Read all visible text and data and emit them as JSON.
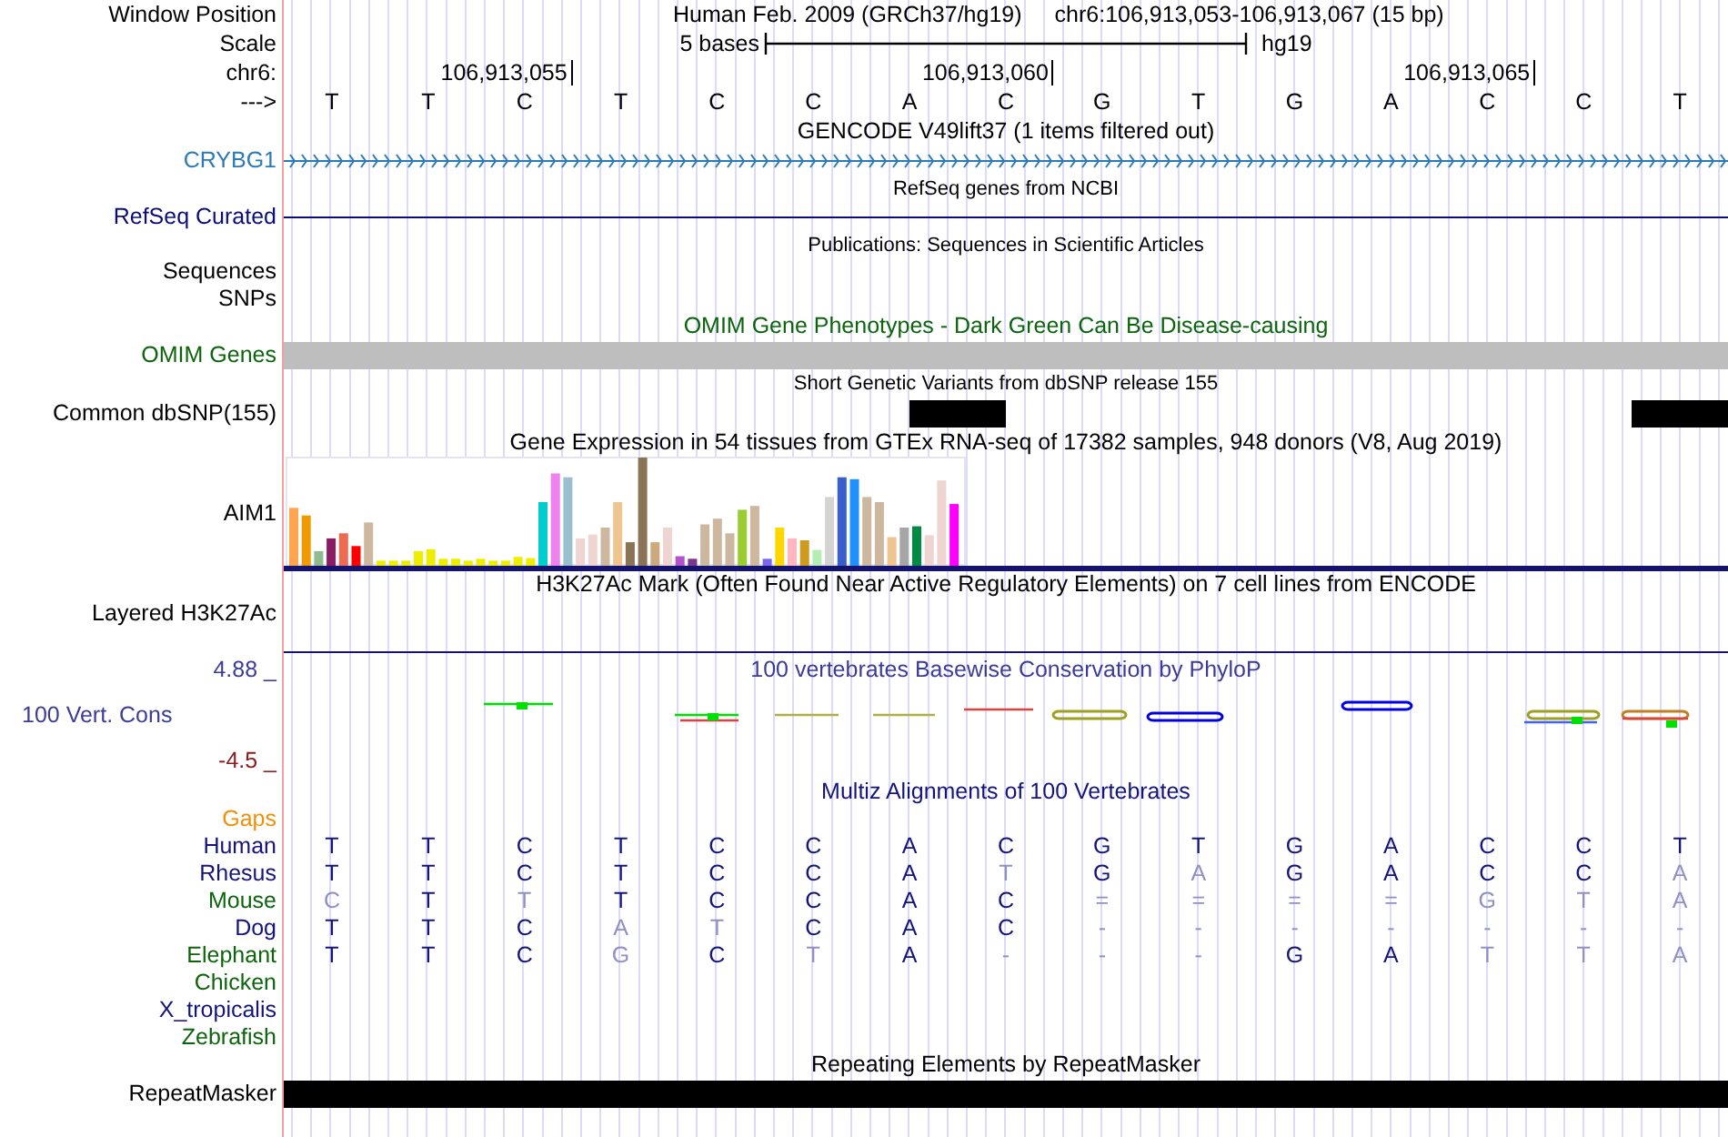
{
  "header": {
    "position_label": "Window Position",
    "assembly_name": "Human Feb. 2009 (GRCh37/hg19)",
    "range": "chr6:106,913,053-106,913,067 (15 bp)",
    "scale_label": "Scale",
    "scale_text": "5 bases",
    "scale_assembly": "hg19",
    "chrom_label": "chr6:",
    "ticks": [
      "106,913,055",
      "106,913,060",
      "106,913,065"
    ],
    "strand_label": "--->",
    "bases": [
      "T",
      "T",
      "C",
      "T",
      "C",
      "C",
      "A",
      "C",
      "G",
      "T",
      "G",
      "A",
      "C",
      "C",
      "T"
    ]
  },
  "tracks": [
    {
      "kind": "title",
      "text": "GENCODE V49lift37 (1 items filtered out)",
      "color": "#000000"
    },
    {
      "kind": "gene",
      "label": "CRYBG1",
      "color": "#2c7bb6"
    },
    {
      "kind": "small_title",
      "text": "RefSeq genes from NCBI",
      "color": "#000000"
    },
    {
      "kind": "line",
      "label": "RefSeq Curated",
      "color": "#0c0c78"
    },
    {
      "kind": "small_title",
      "text": "Publications: Sequences in Scientific Articles",
      "color": "#000000"
    },
    {
      "kind": "label",
      "label": "Sequences",
      "color": "#000000"
    },
    {
      "kind": "label",
      "label": "SNPs",
      "color": "#000000"
    },
    {
      "kind": "title",
      "text": "OMIM Gene Phenotypes - Dark Green Can Be Disease-causing",
      "color": "#0c640c"
    },
    {
      "kind": "bar",
      "label": "OMIM Genes",
      "color": "#0c640c",
      "bar": {
        "color": "#bebebe"
      }
    },
    {
      "kind": "small_title",
      "text": "Short Genetic Variants from dbSNP release 155",
      "color": "#000000"
    },
    {
      "kind": "variants",
      "label": "Common dbSNP(155)",
      "color": "#000000",
      "marks": [
        false,
        false,
        false,
        false,
        false,
        false,
        false,
        false,
        false,
        false,
        false,
        false,
        false,
        true,
        true,
        false,
        false,
        false,
        false,
        false,
        false,
        false,
        false,
        false,
        false,
        false,
        false,
        false,
        true,
        true
      ]
    },
    {
      "kind": "title",
      "text": "Gene Expression in 54 tissues from GTEx RNA-seq of 17382 samples, 948 donors (V8, Aug 2019)",
      "color": "#000000"
    },
    {
      "kind": "expression",
      "label": "AIM1",
      "color": "#000000"
    },
    {
      "kind": "title",
      "text": "H3K27Ac Mark (Often Found Near Active Regulatory Elements) on 7 cell lines from ENCODE",
      "color": "#000000"
    },
    {
      "kind": "layered",
      "label": "Layered H3K27Ac",
      "color": "#000000"
    },
    {
      "kind": "conservation",
      "upper": "4.88 _",
      "label": "100 Vert. Cons",
      "lower": "-4.5 _",
      "text": "100 vertebrates Basewise Conservation by PhyloP",
      "color": "#3c3c96"
    },
    {
      "kind": "title",
      "text": "Multiz Alignments of 100 Vertebrates",
      "color": "#14147a"
    },
    {
      "kind": "label",
      "label": "Gaps",
      "color": "#f0900a"
    },
    {
      "kind": "alignment",
      "label": "Human",
      "color": "#14147a",
      "cells": [
        {
          "base": "T",
          "dim": false
        },
        {
          "base": "T",
          "dim": false
        },
        {
          "base": "C",
          "dim": false
        },
        {
          "base": "T",
          "dim": false
        },
        {
          "base": "C",
          "dim": false
        },
        {
          "base": "C",
          "dim": false
        },
        {
          "base": "A",
          "dim": false
        },
        {
          "base": "C",
          "dim": false
        },
        {
          "base": "G",
          "dim": false
        },
        {
          "base": "T",
          "dim": false
        },
        {
          "base": "G",
          "dim": false
        },
        {
          "base": "A",
          "dim": false
        },
        {
          "base": "C",
          "dim": false
        },
        {
          "base": "C",
          "dim": false
        },
        {
          "base": "T",
          "dim": false
        }
      ]
    },
    {
      "kind": "alignment",
      "label": "Rhesus",
      "color": "#14147a",
      "cells": [
        {
          "base": "T",
          "dim": false
        },
        {
          "base": "T",
          "dim": false
        },
        {
          "base": "C",
          "dim": false
        },
        {
          "base": "T",
          "dim": false
        },
        {
          "base": "C",
          "dim": false
        },
        {
          "base": "C",
          "dim": false
        },
        {
          "base": "A",
          "dim": false
        },
        {
          "base": "T",
          "dim": true
        },
        {
          "base": "G",
          "dim": false
        },
        {
          "base": "A",
          "dim": true
        },
        {
          "base": "G",
          "dim": false
        },
        {
          "base": "A",
          "dim": false
        },
        {
          "base": "C",
          "dim": false
        },
        {
          "base": "C",
          "dim": false
        },
        {
          "base": "A",
          "dim": true
        }
      ]
    },
    {
      "kind": "alignment",
      "label": "Mouse",
      "color": "#0c640c",
      "cells": [
        {
          "base": "C",
          "dim": true
        },
        {
          "base": "T",
          "dim": false
        },
        {
          "base": "T",
          "dim": true
        },
        {
          "base": "T",
          "dim": false
        },
        {
          "base": "C",
          "dim": false
        },
        {
          "base": "C",
          "dim": false
        },
        {
          "base": "A",
          "dim": false
        },
        {
          "base": "C",
          "dim": false
        },
        {
          "base": "=",
          "dim": true
        },
        {
          "base": "=",
          "dim": true
        },
        {
          "base": "=",
          "dim": true
        },
        {
          "base": "=",
          "dim": true
        },
        {
          "base": "G",
          "dim": true
        },
        {
          "base": "T",
          "dim": true
        },
        {
          "base": "A",
          "dim": true
        }
      ]
    },
    {
      "kind": "alignment",
      "label": "Dog",
      "color": "#14147a",
      "cells": [
        {
          "base": "T",
          "dim": false
        },
        {
          "base": "T",
          "dim": false
        },
        {
          "base": "C",
          "dim": false
        },
        {
          "base": "A",
          "dim": true
        },
        {
          "base": "T",
          "dim": true
        },
        {
          "base": "C",
          "dim": false
        },
        {
          "base": "A",
          "dim": false
        },
        {
          "base": "C",
          "dim": false
        },
        {
          "base": "-",
          "dim": true
        },
        {
          "base": "-",
          "dim": true
        },
        {
          "base": "-",
          "dim": true
        },
        {
          "base": "-",
          "dim": true
        },
        {
          "base": "-",
          "dim": true
        },
        {
          "base": "-",
          "dim": true
        },
        {
          "base": "-",
          "dim": true
        }
      ]
    },
    {
      "kind": "alignment",
      "label": "Elephant",
      "color": "#0c640c",
      "cells": [
        {
          "base": "T",
          "dim": false
        },
        {
          "base": "T",
          "dim": false
        },
        {
          "base": "C",
          "dim": false
        },
        {
          "base": "G",
          "dim": true
        },
        {
          "base": "C",
          "dim": false
        },
        {
          "base": "T",
          "dim": true
        },
        {
          "base": "A",
          "dim": false
        },
        {
          "base": "-",
          "dim": true
        },
        {
          "base": "-",
          "dim": true
        },
        {
          "base": "-",
          "dim": true
        },
        {
          "base": "G",
          "dim": false
        },
        {
          "base": "A",
          "dim": false
        },
        {
          "base": "T",
          "dim": true
        },
        {
          "base": "T",
          "dim": true
        },
        {
          "base": "A",
          "dim": true
        }
      ]
    },
    {
      "kind": "label",
      "label": "Chicken",
      "color": "#0c640c"
    },
    {
      "kind": "label",
      "label": "X_tropicalis",
      "color": "#14147a"
    },
    {
      "kind": "label",
      "label": "Zebrafish",
      "color": "#0c640c"
    },
    {
      "kind": "title",
      "text": "Repeating Elements by RepeatMasker",
      "color": "#000000"
    },
    {
      "kind": "bar",
      "label": "RepeatMasker",
      "color": "#000000",
      "bar": {
        "color": "#000000"
      }
    }
  ]
}
